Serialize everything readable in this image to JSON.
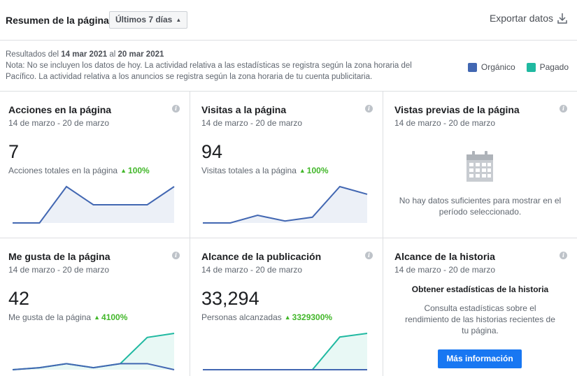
{
  "header": {
    "title": "Resumen de la página",
    "range_label": "Últimos 7 días",
    "export_label": "Exportar datos"
  },
  "notes": {
    "results_prefix": "Resultados del",
    "start_date": "14 mar 2021",
    "connector": "al",
    "end_date": "20 mar 2021",
    "note_line": "Nota: No se incluyen los datos de hoy. La actividad relativa a las estadísticas se registra según la zona horaria del Pacífico. La actividad relativa a los anuncios se registra según la zona horaria de tu cuenta publicitaria."
  },
  "legend": {
    "organic_label": "Orgánico",
    "organic_color": "#4267b2",
    "paid_label": "Pagado",
    "paid_color": "#20b9a1"
  },
  "cards": {
    "actions": {
      "title": "Acciones en la página",
      "date": "14 de marzo - 20 de marzo",
      "value": "7",
      "subtitle": "Acciones totales en la página",
      "change": "100%",
      "organic": [
        0,
        0,
        2,
        1,
        1,
        1,
        2
      ]
    },
    "visits": {
      "title": "Visitas a la página",
      "date": "14 de marzo - 20 de marzo",
      "value": "94",
      "subtitle": "Visitas totales a la página",
      "change": "100%",
      "organic": [
        0,
        0,
        8,
        2,
        6,
        38,
        30
      ]
    },
    "previews": {
      "title": "Vistas previas de la página",
      "date": "14 de marzo - 20 de marzo",
      "message": "No hay datos suficientes para mostrar en el período seleccionado.",
      "icon": "calendar-icon"
    },
    "likes": {
      "title": "Me gusta de la página",
      "date": "14 de marzo - 20 de marzo",
      "value": "42",
      "subtitle": "Me gusta de la página",
      "change": "4100%",
      "organic": [
        0,
        1,
        3,
        1,
        3,
        3,
        0
      ],
      "paid": [
        0,
        1,
        3,
        1,
        3,
        16,
        18
      ]
    },
    "reach": {
      "title": "Alcance de la publicación",
      "date": "14 de marzo - 20 de marzo",
      "value": "33,294",
      "subtitle": "Personas alcanzadas",
      "change": "3329300%",
      "organic": [
        0,
        0,
        0,
        0,
        0,
        0,
        0
      ],
      "paid": [
        0,
        0,
        0,
        0,
        0,
        9,
        10
      ]
    },
    "story": {
      "title": "Alcance de la historia",
      "date": "14 de marzo - 20 de marzo",
      "heading": "Obtener estadísticas de la historia",
      "text": "Consulta estadísticas sobre el rendimiento de las historias recientes de tu página.",
      "button_label": "Más información"
    }
  }
}
